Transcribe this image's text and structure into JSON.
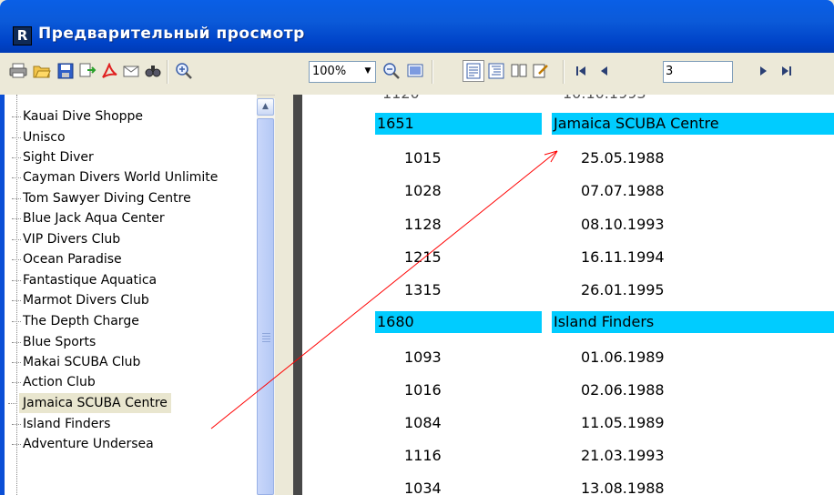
{
  "window": {
    "title": "Предварительный просмотр",
    "app_icon_letter": "R"
  },
  "toolbar": {
    "zoom_value": "100%",
    "page_number": "3",
    "icons": [
      "print-icon",
      "open-icon",
      "save-icon",
      "export-icon",
      "pdf-icon",
      "email-icon",
      "find-icon",
      "zoom-in-icon",
      "zoom-out-icon",
      "whole-page-icon",
      "page-width-icon",
      "outline-icon",
      "thumbnails-icon",
      "edit-icon",
      "first-page-icon",
      "prev-page-icon",
      "next-page-icon",
      "last-page-icon"
    ]
  },
  "tree": {
    "items": [
      "Kauai Dive Shoppe",
      "Unisco",
      "Sight Diver",
      "Cayman Divers World Unlimite",
      "Tom Sawyer Diving Centre",
      "Blue Jack Aqua Center",
      "VIP Divers Club",
      "Ocean Paradise",
      "Fantastique Aquatica",
      "Marmot Divers Club",
      "The Depth Charge",
      "Blue Sports",
      "Makai SCUBA Club",
      "Action Club",
      "Jamaica SCUBA Centre",
      "Island Finders",
      "Adventure Undersea"
    ],
    "selected": "Jamaica SCUBA Centre"
  },
  "report": {
    "groups": [
      {
        "id": "1651",
        "name": "Jamaica SCUBA Centre",
        "rows": [
          [
            "1015",
            "25.05.1988"
          ],
          [
            "1028",
            "07.07.1988"
          ],
          [
            "1128",
            "08.10.1993"
          ],
          [
            "1215",
            "16.11.1994"
          ],
          [
            "1315",
            "26.01.1995"
          ]
        ]
      },
      {
        "id": "1680",
        "name": "Island Finders",
        "rows": [
          [
            "1093",
            "01.06.1989"
          ],
          [
            "1016",
            "02.06.1988"
          ],
          [
            "1084",
            "11.05.1989"
          ],
          [
            "1116",
            "21.03.1993"
          ],
          [
            "1034",
            "13.08.1988"
          ]
        ]
      }
    ],
    "header_color": "#00ccff"
  },
  "colors": {
    "titlebar": "#0a5fe6",
    "arrow": "#ff0000"
  }
}
